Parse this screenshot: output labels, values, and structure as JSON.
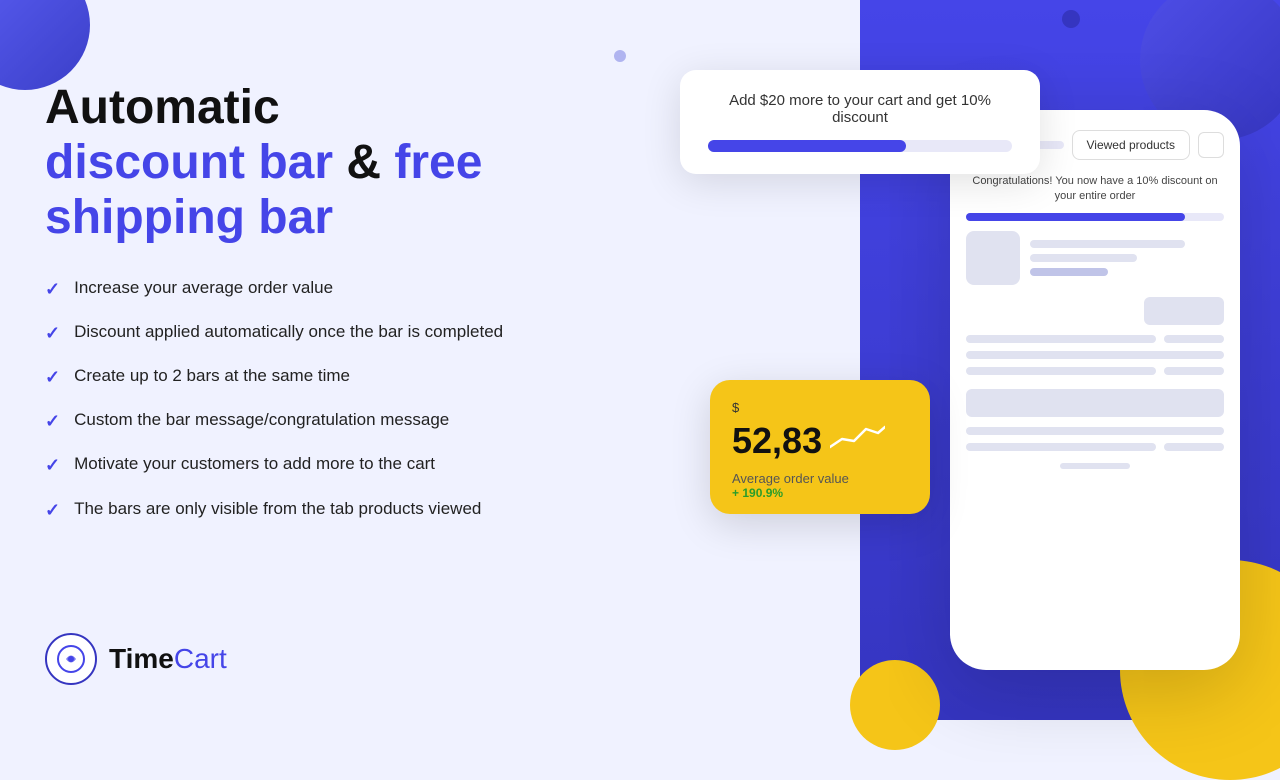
{
  "headline": {
    "line1": "Automatic",
    "line2_part1": "discount bar",
    "line2_connector": " & ",
    "line2_part2": "free",
    "line3_part1": "shipping bar"
  },
  "features": [
    "Increase your average order value",
    "Discount applied automatically once the bar is completed",
    "Create up to 2 bars at the same time",
    "Custom the bar message/congratulation message",
    "Motivate your customers to add more to the cart",
    "The bars are only visible from the tab products viewed"
  ],
  "discount_bar": {
    "message": "Add $20 more to your cart and get 10% discount",
    "progress_pct": 65
  },
  "viewed_products_btn": "Viewed products",
  "congrats_message": "Congratulations! You now have a 10% discount on your entire order",
  "stats_card": {
    "currency_symbol": "$",
    "value": "52,83",
    "label": "Average order value",
    "pct_change": "+ 190.9%"
  },
  "logo": {
    "text_black": "Time",
    "text_blue": "Cart"
  },
  "colors": {
    "accent": "#4545e8",
    "yellow": "#f5c518",
    "bg": "#f0f2ff",
    "white": "#ffffff"
  }
}
